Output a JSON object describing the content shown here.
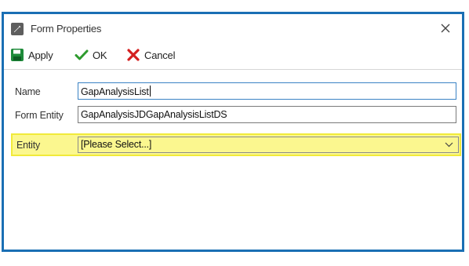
{
  "window": {
    "title": "Form Properties",
    "title_icon": "pencil-icon",
    "close_icon": "close-icon"
  },
  "toolbar": {
    "apply_label": "Apply",
    "ok_label": "OK",
    "cancel_label": "Cancel",
    "apply_icon": "save-icon",
    "ok_icon": "checkmark-icon",
    "cancel_icon": "x-icon"
  },
  "form": {
    "name_label": "Name",
    "name_value": "GapAnalysisList",
    "form_entity_label": "Form Entity",
    "form_entity_value": "GapAnalysisJDGapAnalysisListDS",
    "entity_label": "Entity",
    "entity_value": "[Please Select...]"
  },
  "colors": {
    "window_border": "#1a6fb4",
    "highlight_fill": "#fbf78f",
    "highlight_border": "#f1ea3a",
    "apply_green": "#1e8b3a",
    "ok_green": "#2e9b2e",
    "cancel_red": "#d42020"
  }
}
